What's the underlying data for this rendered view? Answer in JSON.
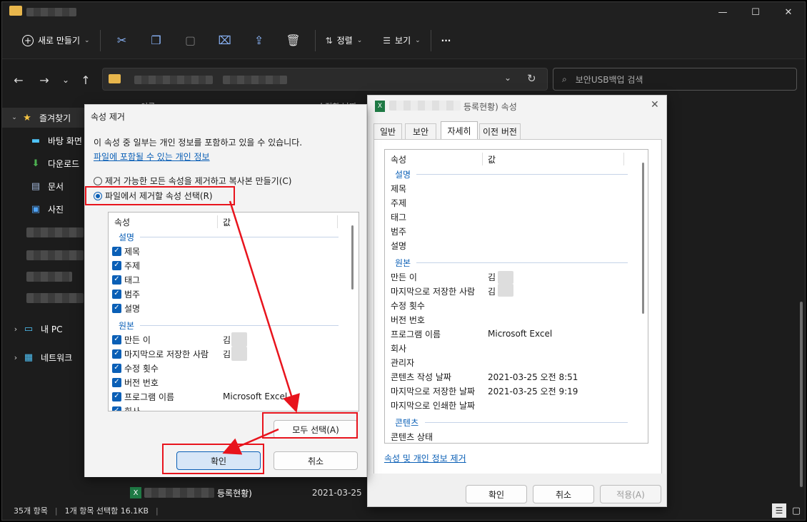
{
  "toolbar": {
    "new_label": "새로 만들기",
    "sort_label": "정렬",
    "view_label": "보기",
    "more_label": "···"
  },
  "search": {
    "placeholder": "보안USB백업 검색"
  },
  "sidebar": {
    "favorites": "즐겨찾기",
    "items": [
      "바탕 화면",
      "다운로드",
      "문서",
      "사진"
    ],
    "pc": "내 PC",
    "network": "네트워크"
  },
  "file_list": {
    "col_name": "이름",
    "col_modified": "수정한 날짜",
    "row_name_suffix": "등록현황)",
    "row_date": "2021-03-25"
  },
  "status": {
    "items": "35개 항목",
    "selected": "1개 항목 선택함 16.1KB"
  },
  "remove_dialog": {
    "title": "속성 제거",
    "info": "이 속성 중 일부는 개인 정보를 포함하고 있을 수 있습니다.",
    "info_link": "파일에 포함될 수 있는 개인 정보",
    "option_copy": "제거 가능한 모든 속성을 제거하고 복사본 만들기(C)",
    "option_select": "파일에서 제거할 속성 선택(R)",
    "col_property": "속성",
    "col_value": "값",
    "group_desc": "설명",
    "desc_items": [
      "제목",
      "주제",
      "태그",
      "범주",
      "설명"
    ],
    "group_origin": "원본",
    "origin_items": [
      {
        "label": "만든 이",
        "value": "김"
      },
      {
        "label": "마지막으로 저장한 사람",
        "value": "김"
      },
      {
        "label": "수정 횟수",
        "value": ""
      },
      {
        "label": "버전 번호",
        "value": ""
      },
      {
        "label": "프로그램 이름",
        "value": "Microsoft Excel"
      },
      {
        "label": "회사",
        "value": ""
      }
    ],
    "select_all": "모두 선택(A)",
    "ok": "확인",
    "cancel": "취소"
  },
  "props_dialog": {
    "title_suffix": "등록현황) 속성",
    "tabs": [
      "일반",
      "보안",
      "자세히",
      "이전 버전"
    ],
    "col_property": "속성",
    "col_value": "값",
    "group_desc": "설명",
    "desc_items": [
      "제목",
      "주제",
      "태그",
      "범주",
      "설명"
    ],
    "group_origin": "원본",
    "origin_items": [
      {
        "label": "만든 이",
        "value": "김"
      },
      {
        "label": "마지막으로 저장한 사람",
        "value": "김"
      },
      {
        "label": "수정 횟수",
        "value": ""
      },
      {
        "label": "버전 번호",
        "value": ""
      },
      {
        "label": "프로그램 이름",
        "value": "Microsoft Excel"
      },
      {
        "label": "회사",
        "value": ""
      },
      {
        "label": "관리자",
        "value": ""
      },
      {
        "label": "콘텐츠 작성 날짜",
        "value": "2021-03-25 오전 8:51"
      },
      {
        "label": "마지막으로 저장한 날짜",
        "value": "2021-03-25 오전 9:19"
      },
      {
        "label": "마지막으로 인쇄한 날짜",
        "value": ""
      }
    ],
    "group_content": "콘텐츠",
    "content_items": [
      "콘텐츠 상태"
    ],
    "remove_link": "속성 및 개인 정보 제거",
    "ok": "확인",
    "cancel": "취소",
    "apply": "적용(A)"
  },
  "colors": {
    "accent": "#0a5fb6",
    "annotation": "#e8141d"
  }
}
